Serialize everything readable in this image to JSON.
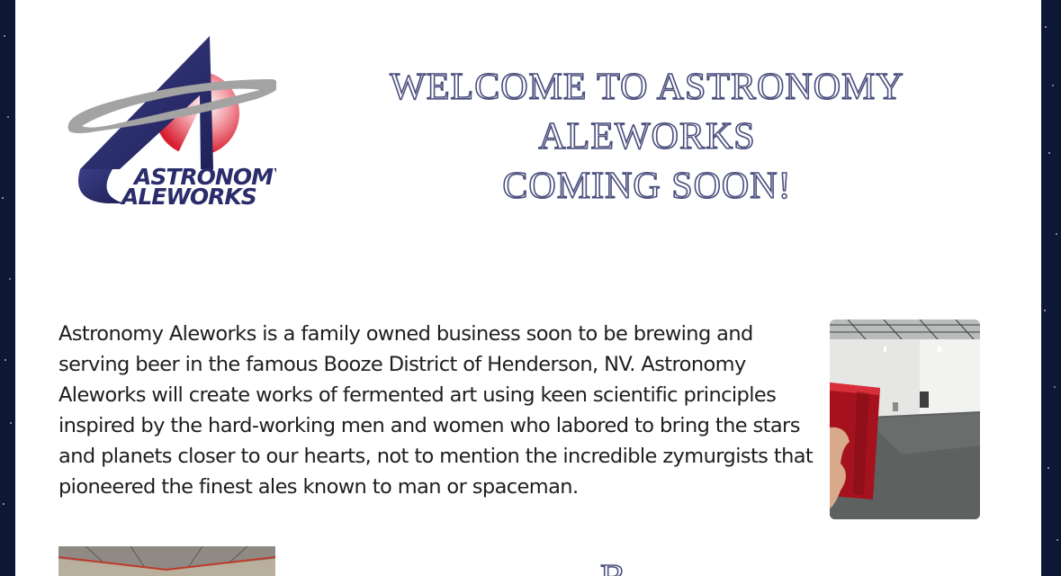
{
  "header": {
    "logo": {
      "icon": "astronomy-aleworks-logo",
      "line1": "ASTRONOMY",
      "line2": "ALEWORKS"
    },
    "headline": {
      "line1": "WELCOME TO ASTRONOMY",
      "line2": "ALEWORKS",
      "line3": "COMING SOON!"
    }
  },
  "main": {
    "intro_text": "Astronomy Aleworks is a family owned business soon to be brewing and serving beer in the famous Booze District of Henderson, NV. Astronomy Aleworks will create works of fermented art using keen scientific principles inspired by the hard-working men and women who labored to bring the stars and planets closer to our hearts, not to mention the incredible zymurgists that pioneered the finest ales known to man or spaceman.",
    "photos": [
      {
        "name": "red-cup-warehouse-photo"
      },
      {
        "name": "warehouse-ceiling-photo"
      }
    ],
    "next_heading": "B"
  },
  "colors": {
    "logo_navy": "#2a2c6b",
    "logo_red": "#e0283a",
    "logo_gray": "#a3a3a3",
    "headline_outline": "#4a4f7d",
    "body_text": "#1e1e1e",
    "page_background": "#ffffff",
    "site_background": "#0d1736"
  }
}
